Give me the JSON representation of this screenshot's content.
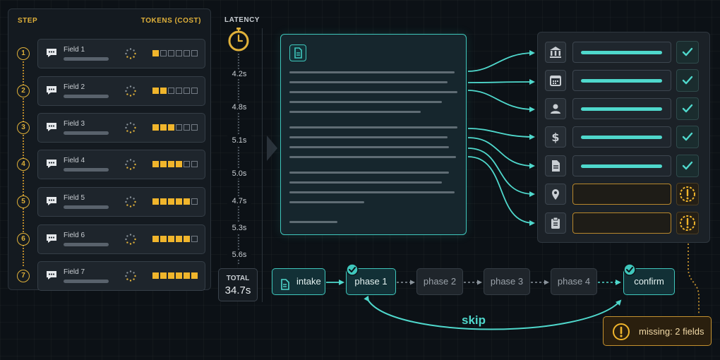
{
  "steps_panel": {
    "step_header": "STEP",
    "tokens_header": "TOKENS (COST)",
    "token_scale_max": 6,
    "steps": [
      {
        "num": "1",
        "label": "Field 1",
        "tokens": 1
      },
      {
        "num": "2",
        "label": "Field 2",
        "tokens": 2
      },
      {
        "num": "3",
        "label": "Field 3",
        "tokens": 3
      },
      {
        "num": "4",
        "label": "Field 4",
        "tokens": 4
      },
      {
        "num": "5",
        "label": "Field 5",
        "tokens": 5
      },
      {
        "num": "6",
        "label": "Field 6",
        "tokens": 5
      },
      {
        "num": "7",
        "label": "Field 7",
        "tokens": 6
      }
    ]
  },
  "latency": {
    "header": "LATENCY",
    "values": [
      "4.2s",
      "4.8s",
      "5.1s",
      "5.0s",
      "4.7s",
      "5.3s",
      "5.6s"
    ],
    "total_label": "TOTAL",
    "total_value": "34.7s"
  },
  "extracted_fields": [
    {
      "icon": "bank-icon",
      "status": "ok"
    },
    {
      "icon": "calendar-icon",
      "status": "ok"
    },
    {
      "icon": "person-icon",
      "status": "ok"
    },
    {
      "icon": "dollar-icon",
      "status": "ok"
    },
    {
      "icon": "document-icon",
      "status": "ok"
    },
    {
      "icon": "location-pin-icon",
      "status": "missing"
    },
    {
      "icon": "clipboard-icon",
      "status": "missing"
    }
  ],
  "flow": {
    "intake": "intake",
    "phase1": "phase 1",
    "phase2": "phase 2",
    "phase3": "phase 3",
    "phase4": "phase 4",
    "confirm": "confirm",
    "skip_label": "skip"
  },
  "missing_badge": "missing: 2 fields",
  "colors": {
    "accent_teal": "#3fc7bc",
    "accent_amber": "#f0b52c",
    "background": "#0c1116"
  }
}
